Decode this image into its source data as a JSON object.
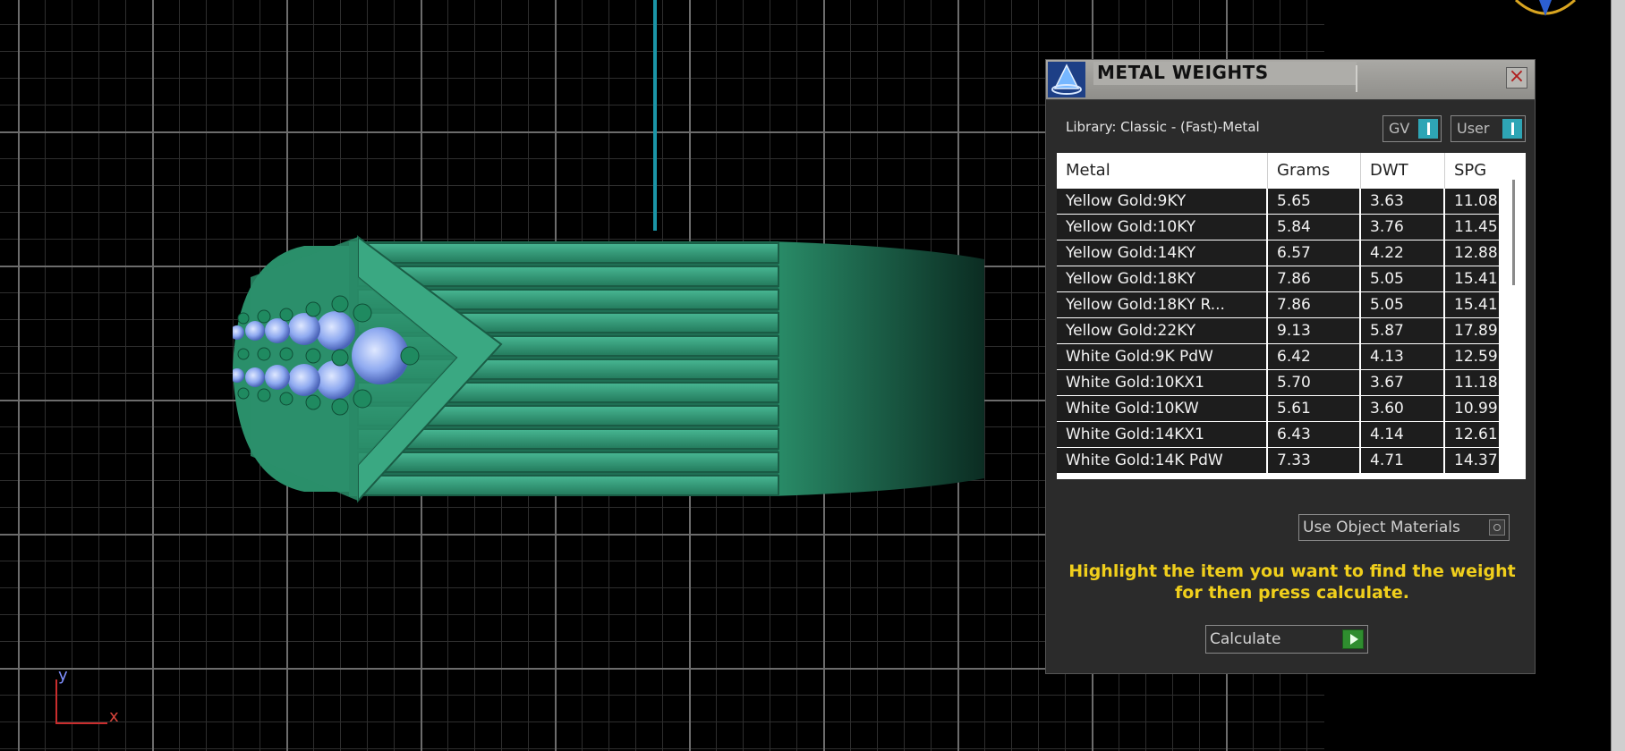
{
  "panel": {
    "title": "METAL WEIGHTS",
    "close_label": "×",
    "library": "Library: Classic - (Fast)-Metal",
    "gv_toggle": "GV",
    "user_toggle": "User",
    "columns": [
      "Metal",
      "Grams",
      "DWT",
      "SPG"
    ],
    "rows": [
      {
        "metal": "Yellow Gold:9KY",
        "grams": "5.65",
        "dwt": "3.63",
        "spg": "11.08"
      },
      {
        "metal": "Yellow Gold:10KY",
        "grams": "5.84",
        "dwt": "3.76",
        "spg": "11.45"
      },
      {
        "metal": "Yellow Gold:14KY",
        "grams": "6.57",
        "dwt": "4.22",
        "spg": "12.88"
      },
      {
        "metal": "Yellow Gold:18KY",
        "grams": "7.86",
        "dwt": "5.05",
        "spg": "15.41"
      },
      {
        "metal": "Yellow Gold:18KY R...",
        "grams": "7.86",
        "dwt": "5.05",
        "spg": "15.41"
      },
      {
        "metal": "Yellow Gold:22KY",
        "grams": "9.13",
        "dwt": "5.87",
        "spg": "17.89"
      },
      {
        "metal": "White Gold:9K PdW",
        "grams": "6.42",
        "dwt": "4.13",
        "spg": "12.59"
      },
      {
        "metal": "White Gold:10KX1",
        "grams": "5.70",
        "dwt": "3.67",
        "spg": "11.18"
      },
      {
        "metal": "White Gold:10KW",
        "grams": "5.61",
        "dwt": "3.60",
        "spg": "10.99"
      },
      {
        "metal": "White Gold:14KX1",
        "grams": "6.43",
        "dwt": "4.14",
        "spg": "12.61"
      },
      {
        "metal": "White Gold:14K PdW",
        "grams": "7.33",
        "dwt": "4.71",
        "spg": "14.37"
      }
    ],
    "use_object_materials": "Use Object Materials",
    "instructions": [
      "Highlight the item you want to find the weight",
      "for then press calculate."
    ],
    "calculate_label": "Calculate"
  },
  "viewport": {
    "axis_y": "y",
    "axis_x": "x"
  },
  "icons": {
    "logo": "gemvision-logo-icon",
    "close": "close-icon",
    "play": "play-icon"
  },
  "colors": {
    "accent_teal": "#2ea5b5",
    "instruction_yellow": "#f0cf1c",
    "ring_green": "#2e9a72"
  }
}
